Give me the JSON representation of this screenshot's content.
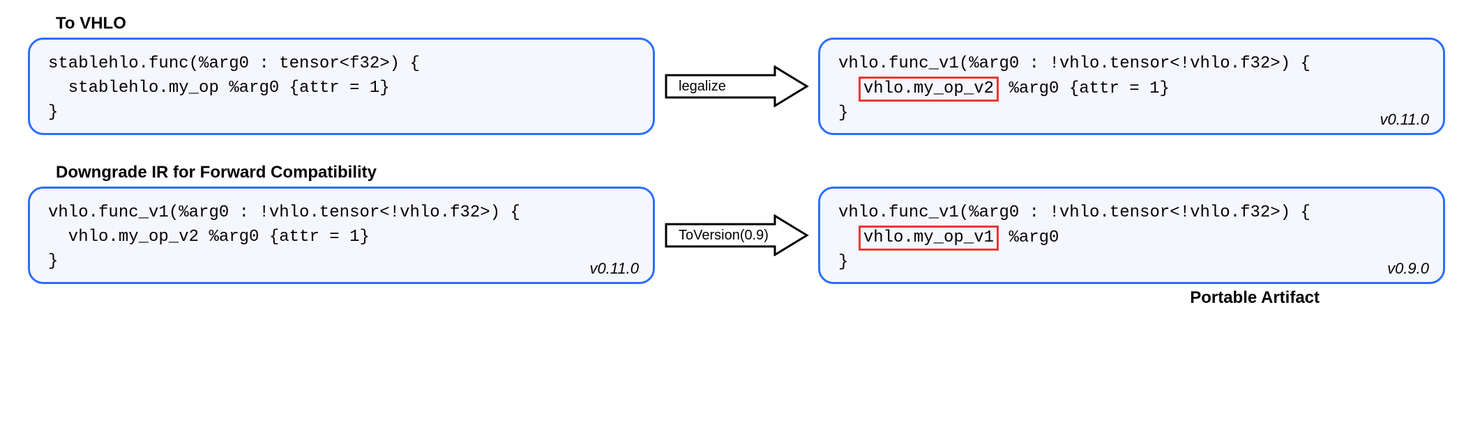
{
  "section1": {
    "title": "To VHLO",
    "left": {
      "line1": "stablehlo.func(%arg0 : tensor<f32>) {",
      "line2": "  stablehlo.my_op %arg0 {attr = 1}",
      "line3": "}"
    },
    "arrow_label": "legalize",
    "right": {
      "line1": "vhlo.func_v1(%arg0 : !vhlo.tensor<!vhlo.f32>) {",
      "indent": "  ",
      "highlight": "vhlo.my_op_v2",
      "rest": " %arg0 {attr = 1}",
      "line3": "}",
      "version": "v0.11.0"
    }
  },
  "section2": {
    "title": "Downgrade IR for Forward Compatibility",
    "left": {
      "line1": "vhlo.func_v1(%arg0 : !vhlo.tensor<!vhlo.f32>) {",
      "line2": "  vhlo.my_op_v2 %arg0 {attr = 1}",
      "line3": "}",
      "version": "v0.11.0"
    },
    "arrow_label": "ToVersion(0.9)",
    "right": {
      "line1": "vhlo.func_v1(%arg0 : !vhlo.tensor<!vhlo.f32>) {",
      "indent": "  ",
      "highlight": "vhlo.my_op_v1",
      "rest": " %arg0",
      "line3": "}",
      "version": "v0.9.0"
    }
  },
  "footer": "Portable Artifact"
}
